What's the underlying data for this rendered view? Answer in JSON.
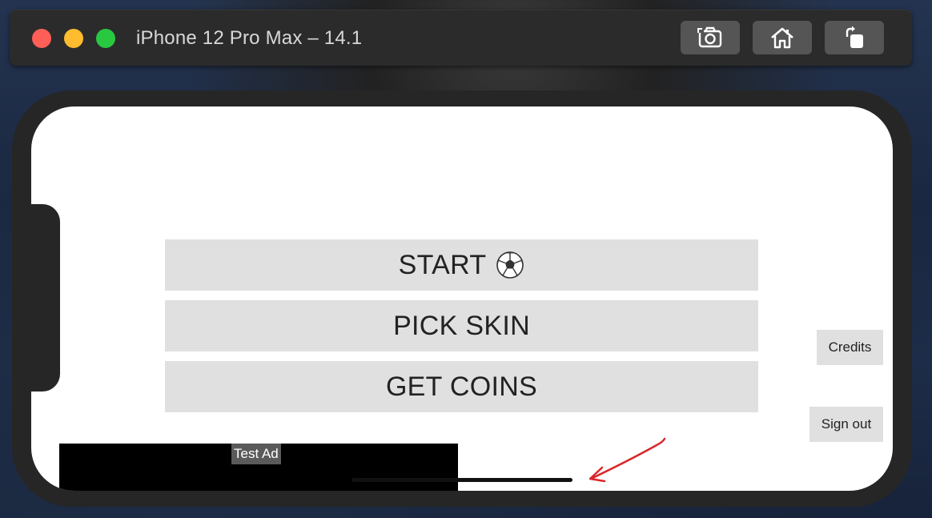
{
  "window": {
    "title": "iPhone 12 Pro Max – 14.1",
    "controls": [
      "close",
      "minimize",
      "zoom"
    ],
    "toolbar_icons": [
      "screenshot-icon",
      "home-icon",
      "rotate-icon"
    ]
  },
  "app": {
    "menu": {
      "start_label": "START",
      "start_icon": "soccer-ball-icon",
      "pick_skin_label": "PICK SKIN",
      "get_coins_label": "GET COINS"
    },
    "credits_label": "Credits",
    "sign_out_label": "Sign out",
    "ad": {
      "label": "Test Ad"
    }
  },
  "colors": {
    "button_bg": "#e0e0e0",
    "annotation": "#d9262b"
  }
}
